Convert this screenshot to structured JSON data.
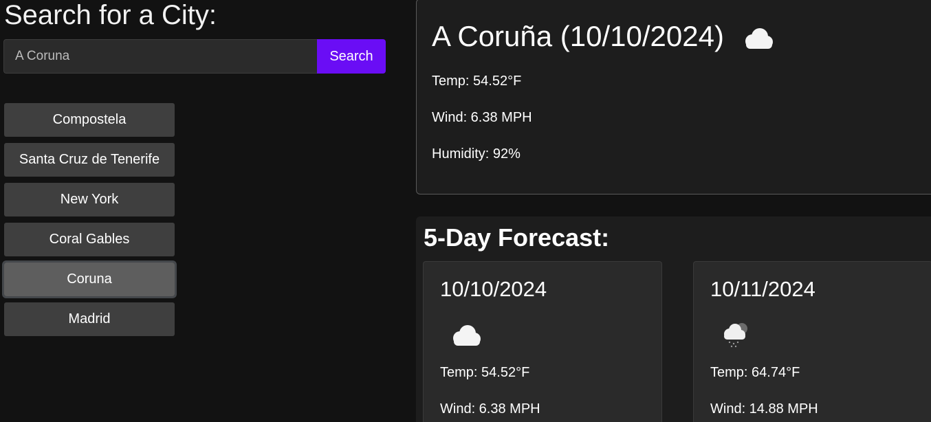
{
  "search": {
    "heading": "Search for a City:",
    "input_value": "A Coruna",
    "button_label": "Search"
  },
  "history": [
    {
      "label": "Compostela"
    },
    {
      "label": "Santa Cruz de Tenerife"
    },
    {
      "label": "New York"
    },
    {
      "label": "Coral Gables"
    },
    {
      "label": "Coruna",
      "active": true
    },
    {
      "label": "Madrid"
    }
  ],
  "current": {
    "title": "A Coruña (10/10/2024)",
    "icon": "cloud-icon",
    "temp": "Temp: 54.52°F",
    "wind": "Wind: 6.38 MPH",
    "humidity": "Humidity: 92%"
  },
  "forecast": {
    "heading": "5-Day Forecast:",
    "days": [
      {
        "date": "10/10/2024",
        "icon": "cloud-icon",
        "temp": "Temp: 54.52°F",
        "wind": "Wind: 6.38 MPH"
      },
      {
        "date": "10/11/2024",
        "icon": "cloud-rain-icon",
        "temp": "Temp: 64.74°F",
        "wind": "Wind: 14.88 MPH"
      }
    ]
  },
  "colors": {
    "accent": "#6a0df5",
    "background": "#121212",
    "panel": "#1d1d1d"
  }
}
